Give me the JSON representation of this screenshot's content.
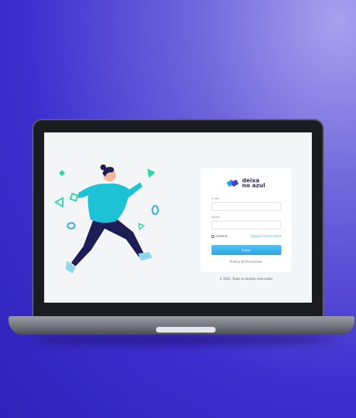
{
  "brand": {
    "name_line1": "deixa",
    "name_line2": "no azul",
    "colors": {
      "primary": "#2fa2e6",
      "text": "#2b2f5a",
      "background": "#3d2fcf"
    }
  },
  "login": {
    "email_label": "E-mail",
    "email_value": "",
    "password_label": "Senha",
    "password_value": "",
    "remember_label": "Lembrar",
    "remember_checked": false,
    "forgot_label": "Esqueci minha senha",
    "submit_label": "Entrar",
    "privacy_label": "Política de Privacidade"
  },
  "footer": {
    "copyright": "© 2022. Todos os direitos reservados"
  }
}
